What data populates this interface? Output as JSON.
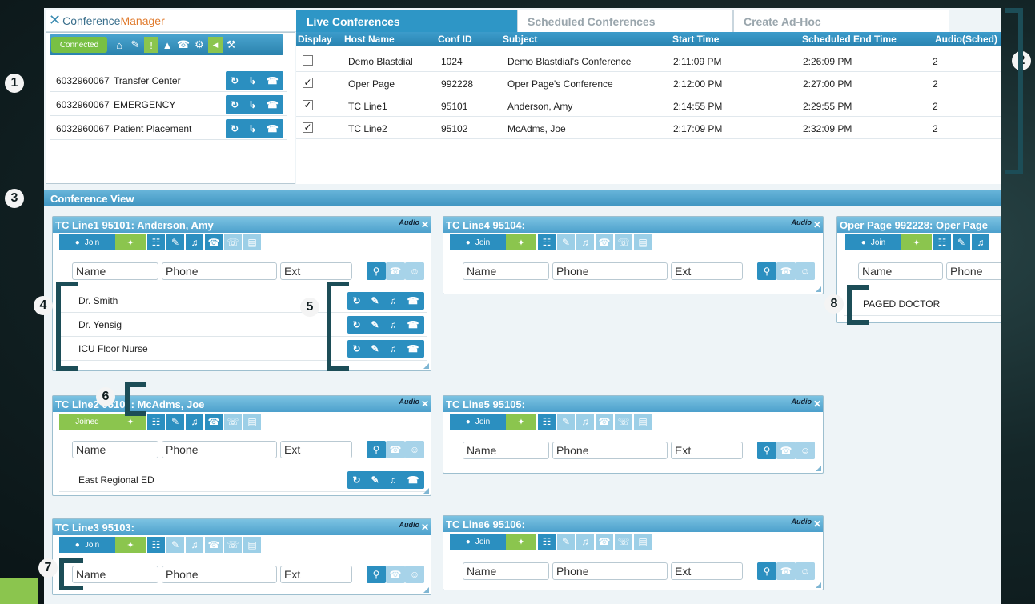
{
  "app": {
    "logo_prefix": "Conference",
    "logo_suffix": "Manager",
    "tabs": [
      {
        "label": "Live Conferences",
        "active": true
      },
      {
        "label": "Scheduled Conferences",
        "active": false
      },
      {
        "label": "Create Ad-Hoc",
        "active": false
      }
    ],
    "section_title": "Conference View"
  },
  "markers": [
    "1",
    "2",
    "3",
    "4",
    "5",
    "6",
    "7",
    "8"
  ],
  "toolbar": {
    "status": "Connected",
    "icons": [
      "home-icon",
      "mute-icon",
      "alert-icon",
      "warning-icon",
      "callback-icon",
      "gear-icon",
      "speaker-icon",
      "wrench-icon"
    ]
  },
  "favorites": [
    {
      "number": "6032960067",
      "name": "Transfer Center"
    },
    {
      "number": "6032960067",
      "name": "EMERGENCY"
    },
    {
      "number": "6032960067",
      "name": "Patient Placement"
    }
  ],
  "conferences_table": {
    "columns": [
      "Display",
      "Host Name",
      "Conf ID",
      "Subject",
      "Start Time",
      "Scheduled End Time",
      "Audio(Sched)"
    ],
    "rows": [
      {
        "display": false,
        "host": "Demo Blastdial",
        "conf_id": "1024",
        "subject": "Demo Blastdial's Conference",
        "start": "2:11:09 PM",
        "end": "2:26:09 PM",
        "audio": "2"
      },
      {
        "display": true,
        "host": "Oper Page",
        "conf_id": "992228",
        "subject": "Oper Page's Conference",
        "start": "2:12:00 PM",
        "end": "2:27:00 PM",
        "audio": "2"
      },
      {
        "display": true,
        "host": "TC Line1",
        "conf_id": "95101",
        "subject": "Anderson, Amy",
        "start": "2:14:55 PM",
        "end": "2:29:55 PM",
        "audio": "2"
      },
      {
        "display": true,
        "host": "TC Line2",
        "conf_id": "95102",
        "subject": "McAdms, Joe",
        "start": "2:17:09 PM",
        "end": "2:32:09 PM",
        "audio": "2"
      }
    ]
  },
  "panel_common": {
    "audio_label": "Audio",
    "join_label": "Join",
    "joined_label": "Joined",
    "name_placeholder": "Name",
    "phone_placeholder": "Phone",
    "ext_placeholder": "Ext"
  },
  "panels": [
    {
      "title": "TC Line1 95101: Anderson, Amy",
      "joined": false,
      "participants": [
        "Dr. Smith",
        "Dr. Yensig",
        "ICU Floor Nurse"
      ]
    },
    {
      "title": "TC Line4 95104:",
      "joined": false,
      "participants": []
    },
    {
      "title": "Oper Page 992228: Oper Page",
      "joined": false,
      "participants": [
        "PAGED DOCTOR"
      ]
    },
    {
      "title": "TC Line2 95102: McAdms, Joe",
      "joined": true,
      "participants": [
        "East Regional ED"
      ]
    },
    {
      "title": "TC Line5 95105:",
      "joined": false,
      "participants": []
    },
    {
      "title": "TC Line3 95103:",
      "joined": false,
      "participants": []
    },
    {
      "title": "TC Line6 95106:",
      "joined": false,
      "participants": []
    }
  ],
  "colors": {
    "accent": "#2b8fc0",
    "green": "#8bc54e",
    "marker_bracket": "#1c4d57"
  }
}
